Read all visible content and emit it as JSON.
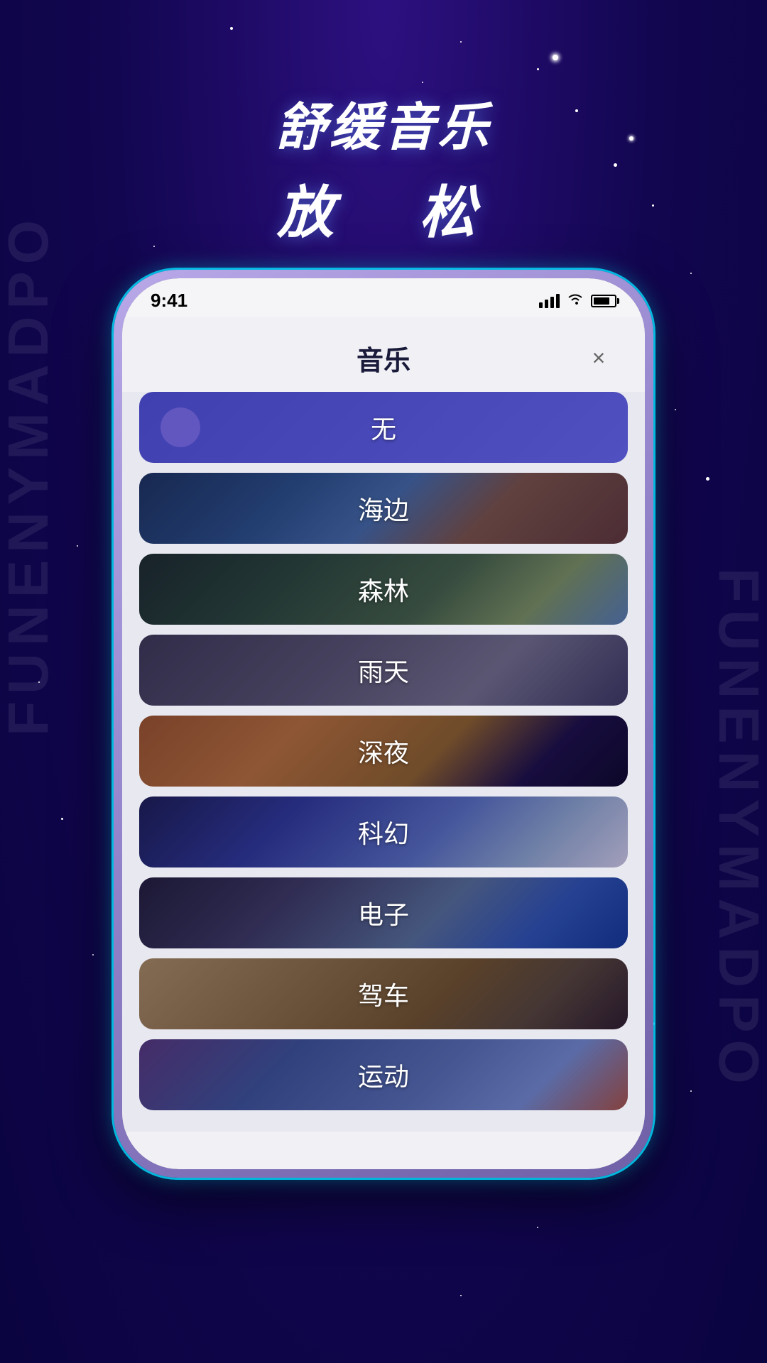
{
  "background": {
    "color": "#1a0a5e"
  },
  "header": {
    "line1": "舒缓音乐",
    "line2": "放　松"
  },
  "phone": {
    "statusBar": {
      "time": "9:41",
      "battery": "80"
    },
    "modal": {
      "title": "音乐",
      "closeLabel": "×"
    },
    "musicItems": [
      {
        "id": "none",
        "label": "无",
        "selected": true,
        "hasImage": false
      },
      {
        "id": "haibain",
        "label": "海边",
        "selected": false,
        "hasImage": true,
        "scene": "haibain"
      },
      {
        "id": "senlin",
        "label": "森林",
        "selected": false,
        "hasImage": true,
        "scene": "senlin"
      },
      {
        "id": "yutian",
        "label": "雨天",
        "selected": false,
        "hasImage": true,
        "scene": "yutian"
      },
      {
        "id": "shenye",
        "label": "深夜",
        "selected": false,
        "hasImage": true,
        "scene": "shenye"
      },
      {
        "id": "kehuan",
        "label": "科幻",
        "selected": false,
        "hasImage": true,
        "scene": "kehuan"
      },
      {
        "id": "dianzi",
        "label": "电子",
        "selected": false,
        "hasImage": true,
        "scene": "dianzi"
      },
      {
        "id": "jiache",
        "label": "驾车",
        "selected": false,
        "hasImage": true,
        "scene": "jiache"
      },
      {
        "id": "yundong",
        "label": "运动",
        "selected": false,
        "hasImage": true,
        "scene": "yundong"
      }
    ]
  },
  "sideTextLeft": "FUNENYMADPO",
  "sideTextRight": "FUNENYMADPO"
}
